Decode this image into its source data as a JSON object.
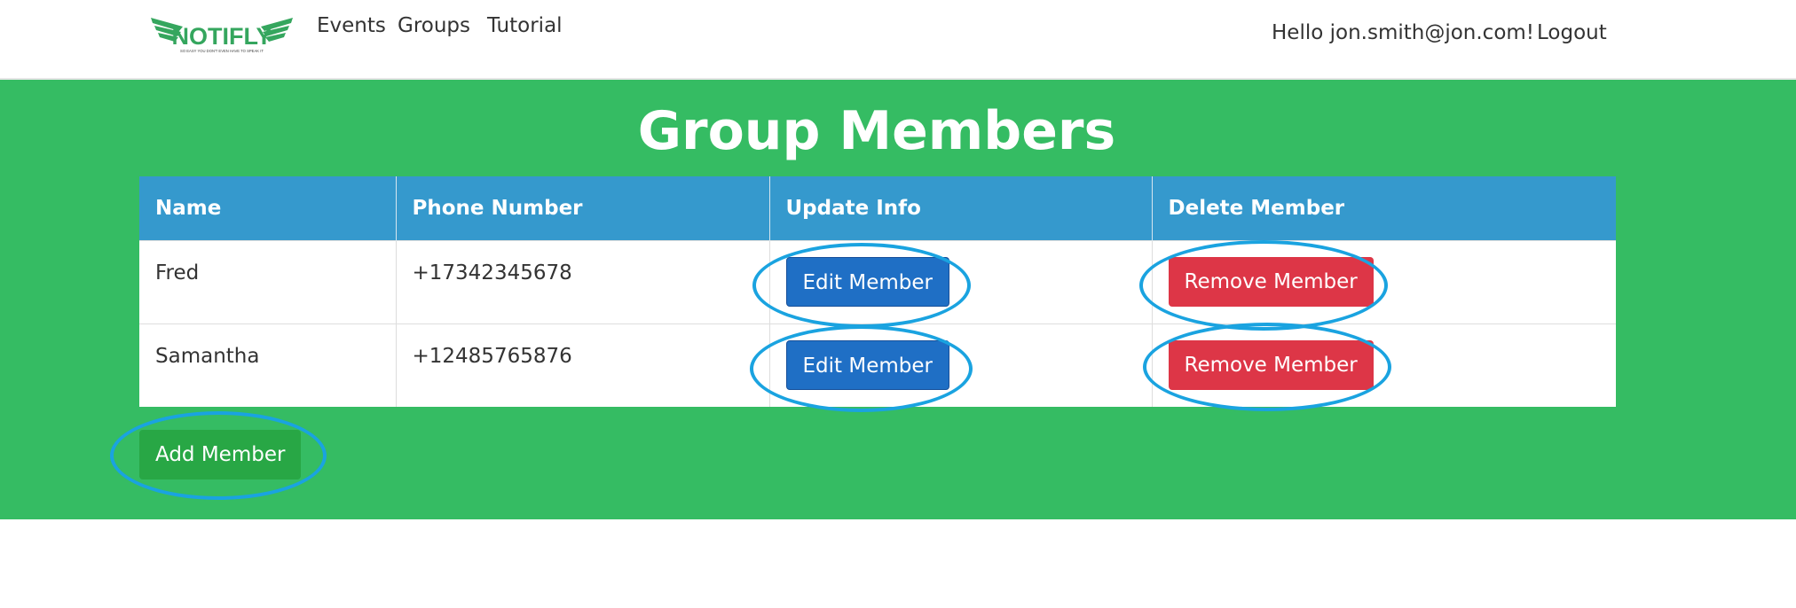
{
  "nav": {
    "brand": "NOTIFLY",
    "brand_tagline": "SO EASY YOU DON'T EVEN HAVE TO SPEAK IT",
    "links": [
      "Events",
      "Groups",
      "Tutorial"
    ],
    "greeting": "Hello jon.smith@jon.com!",
    "logout": "Logout"
  },
  "page": {
    "title": "Group Members"
  },
  "table": {
    "headers": [
      "Name",
      "Phone Number",
      "Update Info",
      "Delete Member"
    ],
    "rows": [
      {
        "name": "Fred",
        "phone": "+17342345678",
        "edit": "Edit Member",
        "remove": "Remove Member"
      },
      {
        "name": "Samantha",
        "phone": "+12485765876",
        "edit": "Edit Member",
        "remove": "Remove Member"
      }
    ]
  },
  "actions": {
    "add_member": "Add Member"
  },
  "colors": {
    "page_green": "#35bc63",
    "header_blue": "#3599cd",
    "edit_blue": "#1f6fc5",
    "remove_red": "#dd3647",
    "add_green": "#28a745",
    "annotation_blue": "#1aa3e0"
  }
}
